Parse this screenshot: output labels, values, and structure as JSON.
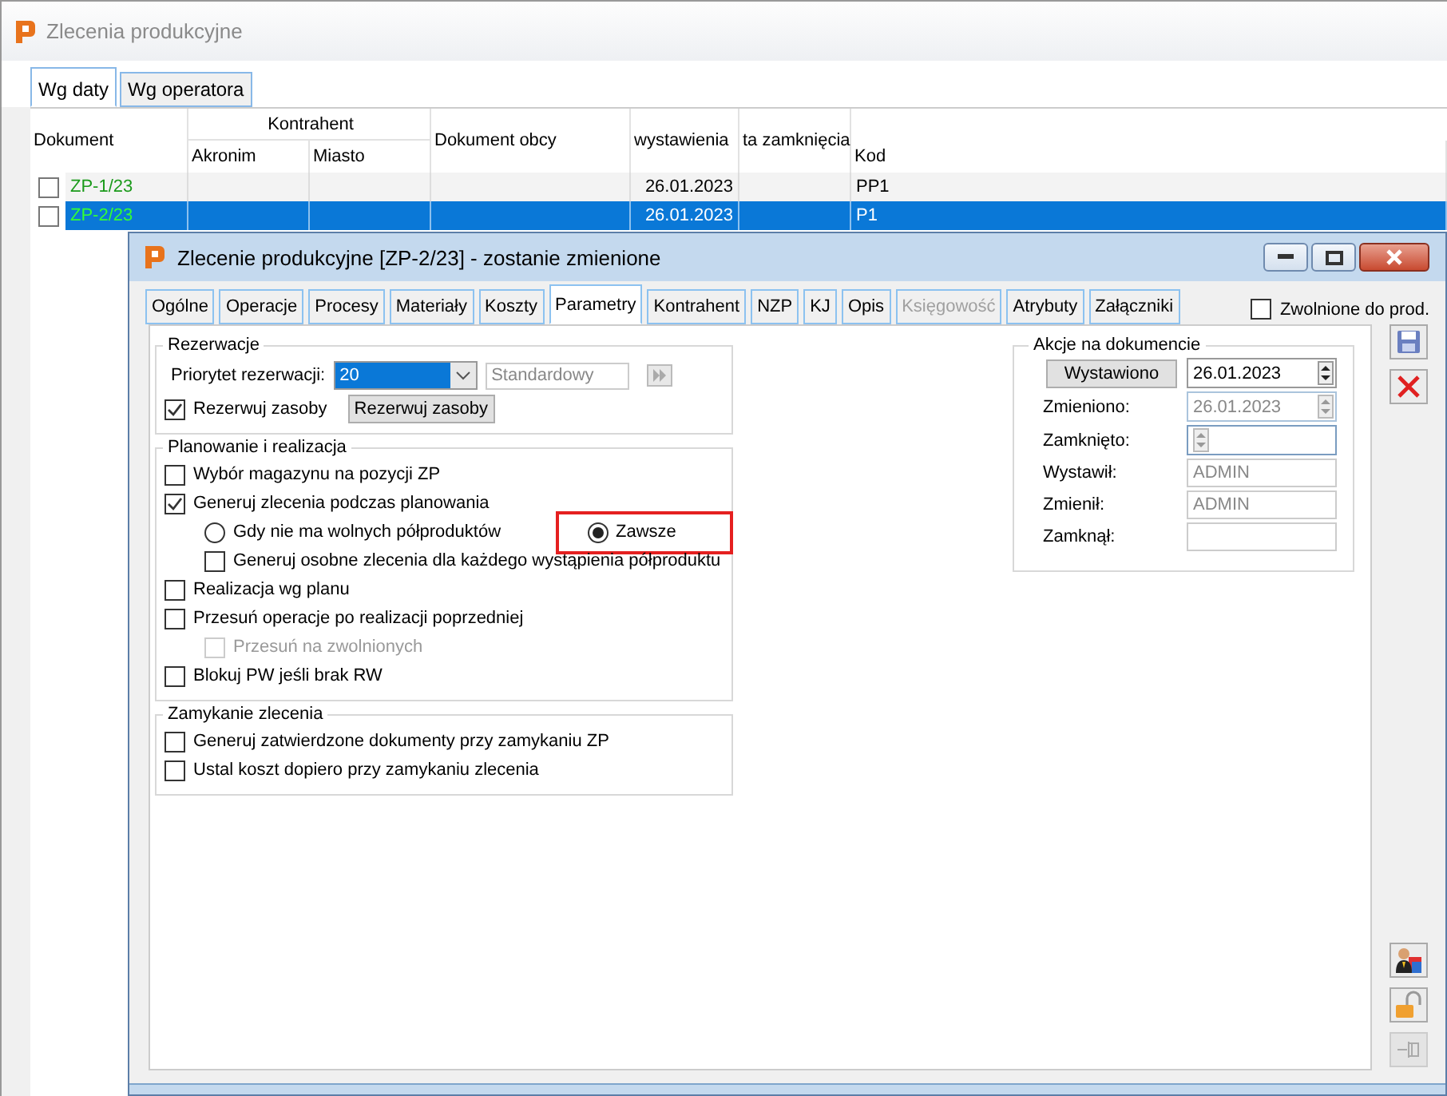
{
  "main_window": {
    "title": "Zlecenia produkcyjne",
    "tabs": [
      {
        "label": "Wg daty",
        "selected": true
      },
      {
        "label": "Wg operatora",
        "selected": false
      }
    ],
    "table": {
      "group_header": "Kontrahent",
      "columns": {
        "document": "Dokument",
        "acronym": "Akronim",
        "city": "Miasto",
        "foreign_document": "Dokument obcy",
        "issued": "wystawienia",
        "closed": "ta zamknięcia",
        "code": "Kod"
      },
      "rows": [
        {
          "checked": false,
          "selected": false,
          "document": "ZP-1/23",
          "issued": "26.01.2023",
          "code": "PP1"
        },
        {
          "checked": false,
          "selected": true,
          "document": "ZP-2/23",
          "issued": "26.01.2023",
          "code": "P1"
        }
      ]
    }
  },
  "dialog": {
    "title": "Zlecenie produkcyjne  [ZP-2/23] - zostanie zmienione",
    "tabs": [
      {
        "label": "Ogólne",
        "selected": false,
        "disabled": false
      },
      {
        "label": "Operacje",
        "selected": false,
        "disabled": false
      },
      {
        "label": "Procesy",
        "selected": false,
        "disabled": false
      },
      {
        "label": "Materiały",
        "selected": false,
        "disabled": false
      },
      {
        "label": "Koszty",
        "selected": false,
        "disabled": false
      },
      {
        "label": "Parametry",
        "selected": true,
        "disabled": false
      },
      {
        "label": "Kontrahent",
        "selected": false,
        "disabled": false
      },
      {
        "label": "NZP",
        "selected": false,
        "disabled": false
      },
      {
        "label": "KJ",
        "selected": false,
        "disabled": false
      },
      {
        "label": "Opis",
        "selected": false,
        "disabled": false
      },
      {
        "label": "Księgowość",
        "selected": false,
        "disabled": true
      },
      {
        "label": "Atrybuty",
        "selected": false,
        "disabled": false
      },
      {
        "label": "Załączniki",
        "selected": false,
        "disabled": false
      }
    ],
    "released": {
      "label": "Zwolnione do prod.",
      "checked": false
    },
    "reservations": {
      "title": "Rezerwacje",
      "priority_label": "Priorytet rezerwacji:",
      "priority_value": "20",
      "priority_name": "Standardowy",
      "reserve": {
        "label": "Rezerwuj zasoby",
        "checked": true
      },
      "reserve_button": "Rezerwuj zasoby"
    },
    "planning": {
      "title": "Planowanie i realizacja",
      "items": [
        {
          "kind": "checkbox",
          "label": "Wybór magazynu na pozycji ZP",
          "checked": false,
          "disabled": false
        },
        {
          "kind": "checkbox",
          "label": "Generuj zlecenia podczas planowania",
          "checked": true,
          "disabled": false,
          "children": [
            {
              "kind": "radio-group",
              "options": [
                {
                  "label": "Gdy nie ma wolnych półproduktów",
                  "selected": false,
                  "highlighted": false
                },
                {
                  "label": "Zawsze",
                  "selected": true,
                  "highlighted": true
                }
              ]
            },
            {
              "kind": "checkbox",
              "label": "Generuj osobne zlecenia dla każdego wystąpienia półproduktu",
              "checked": false,
              "disabled": false
            }
          ]
        },
        {
          "kind": "checkbox",
          "label": "Realizacja wg planu",
          "checked": false,
          "disabled": false
        },
        {
          "kind": "checkbox",
          "label": "Przesuń operacje po realizacji poprzedniej",
          "checked": false,
          "disabled": false,
          "children": [
            {
              "kind": "checkbox",
              "label": "Przesuń na zwolnionych",
              "checked": false,
              "disabled": true
            }
          ]
        },
        {
          "kind": "checkbox",
          "label": "Blokuj PW jeśli brak RW",
          "checked": false,
          "disabled": false
        }
      ]
    },
    "closing": {
      "title": "Zamykanie zlecenia",
      "items": [
        {
          "kind": "checkbox",
          "label": "Generuj zatwierdzone dokumenty przy zamykaniu ZP",
          "checked": false,
          "disabled": false
        },
        {
          "kind": "checkbox",
          "label": "Ustal koszt dopiero przy zamykaniu zlecenia",
          "checked": false,
          "disabled": false
        }
      ]
    },
    "actions": {
      "title": "Akcje na dokumencie",
      "button": "Wystawiono",
      "issued_date": "26.01.2023",
      "fields": [
        {
          "kind": "date",
          "label": "Zmieniono:",
          "value": "26.01.2023",
          "disabled": true
        },
        {
          "kind": "date",
          "label": "Zamknięto:",
          "disabled": false
        },
        {
          "kind": "text",
          "label": "Wystawił:",
          "value": "ADMIN",
          "disabled": true
        },
        {
          "kind": "text",
          "label": "Zmienił:",
          "value": "ADMIN",
          "disabled": true
        },
        {
          "kind": "text",
          "label": "Zamknął:",
          "disabled": true
        }
      ]
    }
  }
}
